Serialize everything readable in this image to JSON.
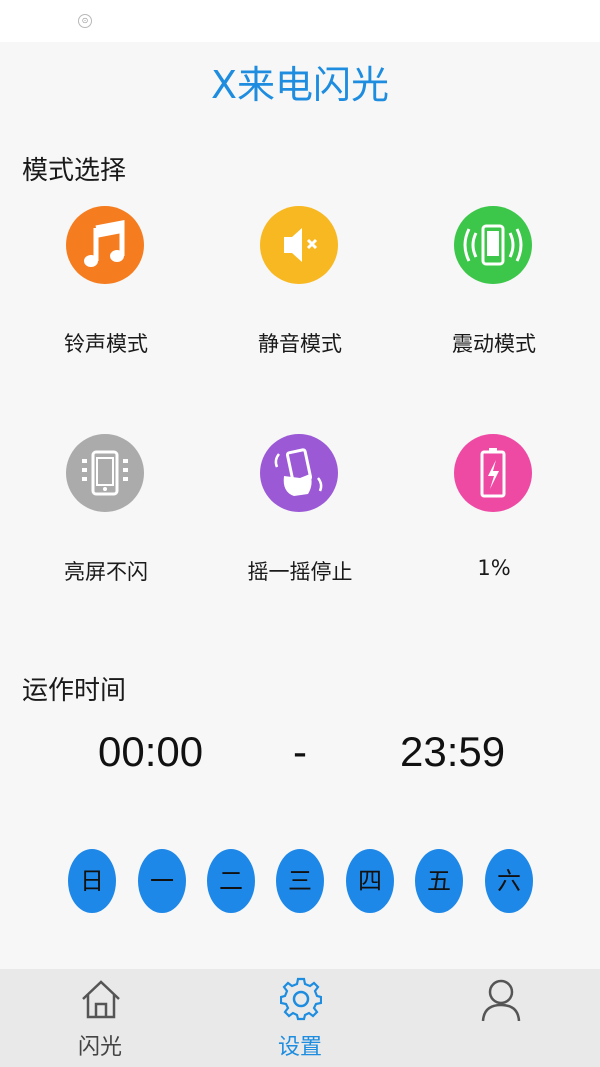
{
  "app_title": "X来电闪光",
  "mode_section": {
    "title": "模式选择",
    "modes": [
      {
        "label": "铃声模式",
        "icon": "music-note-icon",
        "color": "#f57c1f"
      },
      {
        "label": "静音模式",
        "icon": "speaker-mute-icon",
        "color": "#f7b821"
      },
      {
        "label": "震动模式",
        "icon": "phone-vibrate-icon",
        "color": "#3cc64a"
      },
      {
        "label": "亮屏不闪",
        "icon": "phone-screen-icon",
        "color": "#ababab"
      },
      {
        "label": "摇一摇停止",
        "icon": "shake-hand-icon",
        "color": "#9b59d6"
      },
      {
        "label": "1%",
        "icon": "battery-charging-icon",
        "color": "#ee4aa4"
      }
    ]
  },
  "time_section": {
    "title": "运作时间",
    "start": "00:00",
    "separator": "-",
    "end": "23:59",
    "days": [
      "日",
      "一",
      "二",
      "三",
      "四",
      "五",
      "六"
    ]
  },
  "tab_bar": {
    "tabs": [
      {
        "label": "闪光",
        "icon": "home-icon",
        "active": false
      },
      {
        "label": "设置",
        "icon": "gear-icon",
        "active": true
      },
      {
        "label": "",
        "icon": "user-icon",
        "active": false
      }
    ]
  },
  "colors": {
    "accent": "#1e8de0",
    "day_button": "#1e88e8",
    "inactive_tab": "#444444"
  }
}
